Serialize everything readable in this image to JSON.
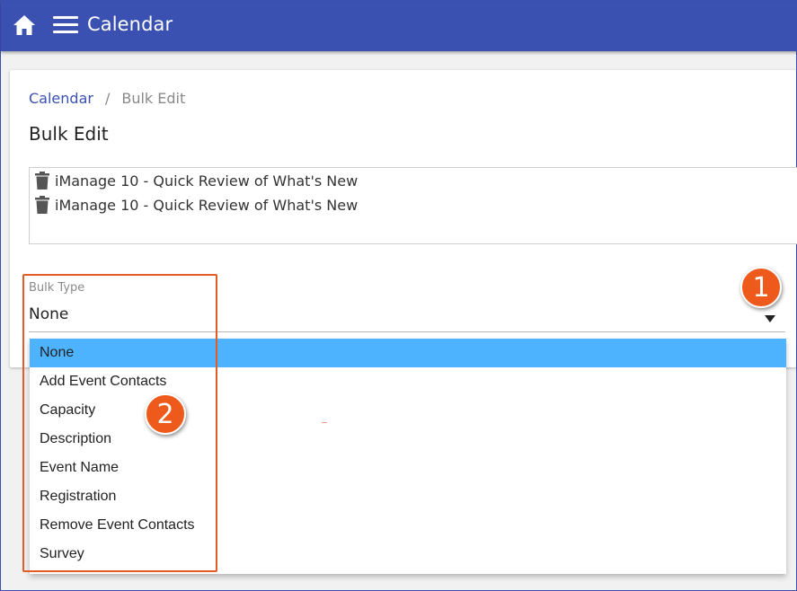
{
  "header": {
    "title": "Calendar",
    "icons": [
      "home-icon",
      "menu-icon"
    ],
    "bar_color": "#3a51b1"
  },
  "breadcrumb": {
    "link": "Calendar",
    "separator": "/",
    "current": "Bulk Edit"
  },
  "page": {
    "title": "Bulk Edit"
  },
  "events": [
    {
      "name": "iManage 10 - Quick Review of What's New",
      "icon": "trash-icon"
    },
    {
      "name": "iManage 10 - Quick Review of What's New",
      "icon": "trash-icon"
    }
  ],
  "bulk_type": {
    "label": "Bulk Type",
    "value": "None",
    "options": [
      {
        "label": "None",
        "selected": true
      },
      {
        "label": "Add Event Contacts",
        "selected": false
      },
      {
        "label": "Capacity",
        "selected": false
      },
      {
        "label": "Description",
        "selected": false
      },
      {
        "label": "Event Name",
        "selected": false
      },
      {
        "label": "Registration",
        "selected": false
      },
      {
        "label": "Remove Event Contacts",
        "selected": false
      },
      {
        "label": "Survey",
        "selected": false
      }
    ],
    "selected_color": "#4db3ff"
  },
  "annotations": {
    "marker_1": "1",
    "marker_2": "2",
    "color": "#ee5a1b"
  }
}
